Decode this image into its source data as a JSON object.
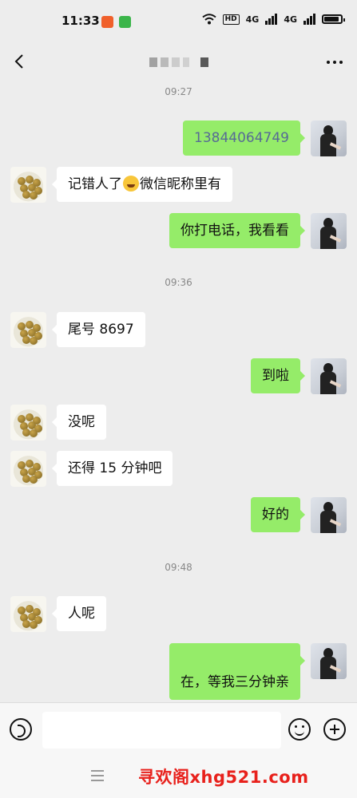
{
  "status_bar": {
    "time": "11:33",
    "hd_label": "HD",
    "net1": "4G",
    "net2": "4G"
  },
  "messages": [
    {
      "type": "time",
      "text": "09:27"
    },
    {
      "type": "out",
      "text": "13844064749"
    },
    {
      "type": "in",
      "text_before": "记错人了",
      "text_after": "微信昵称里有",
      "emoji": "crying-laughing-icon"
    },
    {
      "type": "out",
      "text": "你打电话，我看看"
    },
    {
      "type": "time",
      "text": "09:36"
    },
    {
      "type": "in",
      "text": "尾号 8697"
    },
    {
      "type": "out",
      "text": "到啦"
    },
    {
      "type": "in",
      "text": "没呢"
    },
    {
      "type": "in",
      "text": "还得 15 分钟吧"
    },
    {
      "type": "out",
      "text": "好的"
    },
    {
      "type": "time",
      "text": "09:48"
    },
    {
      "type": "in",
      "text": "人呢"
    },
    {
      "type": "out",
      "text": "在，等我三分钟亲"
    }
  ],
  "watermark": "寻欢阁xhg521.com",
  "colors": {
    "outgoing_bubble": "#95ec69",
    "incoming_bubble": "#ffffff",
    "chat_background": "#ededed",
    "phone_link": "#576b95",
    "watermark": "#e8211c"
  }
}
